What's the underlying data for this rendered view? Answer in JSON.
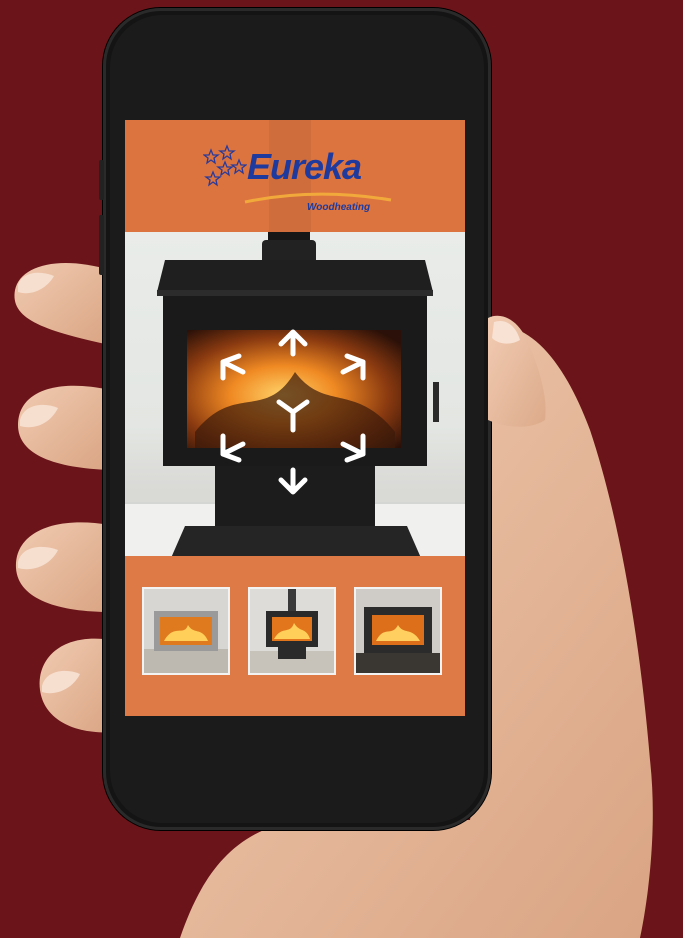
{
  "app": {
    "brand_name": "Eureka",
    "brand_subtitle": "Woodheating",
    "brand_color": "#1f3a9e",
    "accent_color": "#dc7440",
    "background_color": "#6b1419"
  },
  "ar_control": {
    "icon": "move-rotate-arrows-icon"
  },
  "thumbnails": [
    {
      "name": "insert-heater-silver",
      "icon": "fireplace-thumbnail"
    },
    {
      "name": "freestanding-heater-flue",
      "icon": "fireplace-thumbnail"
    },
    {
      "name": "insert-heater-black",
      "icon": "fireplace-thumbnail"
    }
  ]
}
